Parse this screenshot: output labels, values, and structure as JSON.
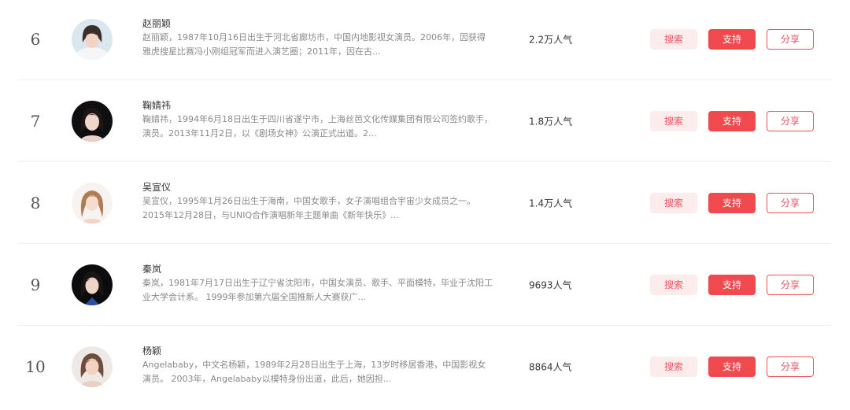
{
  "ranking": {
    "rows": [
      {
        "rank": "6",
        "name": "赵丽颖",
        "description": "赵丽颖，1987年10月16日出生于河北省廊坊市，中国内地影视女演员。2006年，因获得雅虎搜星比赛冯小刚组冠军而进入演艺圈；2011年，因在古...",
        "popularity": "2.2万人气",
        "search_label": "搜索",
        "support_label": "支持",
        "share_label": "分享"
      },
      {
        "rank": "7",
        "name": "鞠婧祎",
        "description": "鞠婧祎，1994年6月18日出生于四川省遂宁市，上海丝芭文化传媒集团有限公司签约歌手，演员。2013年11月2日，以《剧场女神》公演正式出道。2...",
        "popularity": "1.8万人气",
        "search_label": "搜索",
        "support_label": "支持",
        "share_label": "分享"
      },
      {
        "rank": "8",
        "name": "吴宣仪",
        "description": "吴宣仪，1995年1月26日出生于海南，中国女歌手，女子演唱组合宇宙少女成员之一。2015年12月28日，与UNIQ合作演唱新年主题单曲《新年快乐》...",
        "popularity": "1.4万人气",
        "search_label": "搜索",
        "support_label": "支持",
        "share_label": "分享"
      },
      {
        "rank": "9",
        "name": "秦岚",
        "description": "秦岚，1981年7月17日出生于辽宁省沈阳市，中国女演员、歌手、平面模特，毕业于沈阳工业大学会计系。 1999年参加第六届全国推新人大赛获广...",
        "popularity": "9693人气",
        "search_label": "搜索",
        "support_label": "支持",
        "share_label": "分享"
      },
      {
        "rank": "10",
        "name": "杨颖",
        "description": "Angelababy，中文名杨颖，1989年2月28日出生于上海，13岁时移居香港，中国影视女演员。 2003年，Angelababy以模特身份出道，此后，她因担...",
        "popularity": "8864人气",
        "search_label": "搜索",
        "support_label": "支持",
        "share_label": "分享"
      }
    ]
  }
}
